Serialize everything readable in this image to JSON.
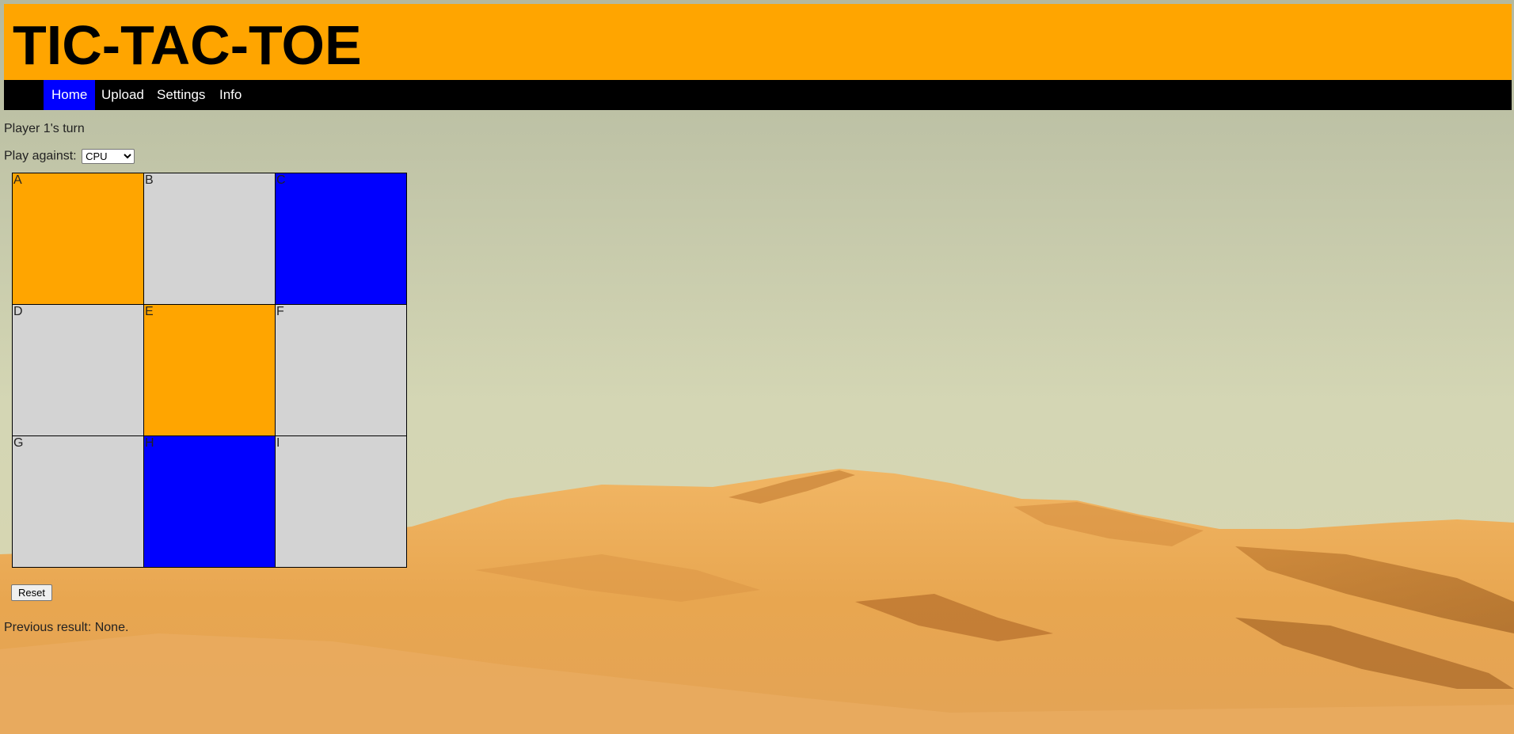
{
  "header": {
    "title": "TIC-TAC-TOE"
  },
  "nav": {
    "items": [
      {
        "label": "Home",
        "active": true
      },
      {
        "label": "Upload",
        "active": false
      },
      {
        "label": "Settings",
        "active": false
      },
      {
        "label": "Info",
        "active": false
      }
    ]
  },
  "status": {
    "turn_text": "Player 1's turn"
  },
  "opponent": {
    "label": "Play against:",
    "selected": "CPU",
    "options": [
      "CPU"
    ]
  },
  "board": {
    "cells": [
      {
        "label": "A",
        "color": "#ffa500"
      },
      {
        "label": "B",
        "color": "#d3d3d3"
      },
      {
        "label": "C",
        "color": "#0000ff"
      },
      {
        "label": "D",
        "color": "#d3d3d3"
      },
      {
        "label": "E",
        "color": "#ffa500"
      },
      {
        "label": "F",
        "color": "#d3d3d3"
      },
      {
        "label": "G",
        "color": "#d3d3d3"
      },
      {
        "label": "H",
        "color": "#0000ff"
      },
      {
        "label": "I",
        "color": "#d3d3d3"
      }
    ]
  },
  "controls": {
    "reset_label": "Reset"
  },
  "result": {
    "text": "Previous result: None."
  },
  "colors": {
    "header_bg": "#ffa500",
    "nav_bg": "#000000",
    "nav_active": "#0000ff",
    "player1": "#ffa500",
    "player2": "#0000ff",
    "empty": "#d3d3d3"
  }
}
